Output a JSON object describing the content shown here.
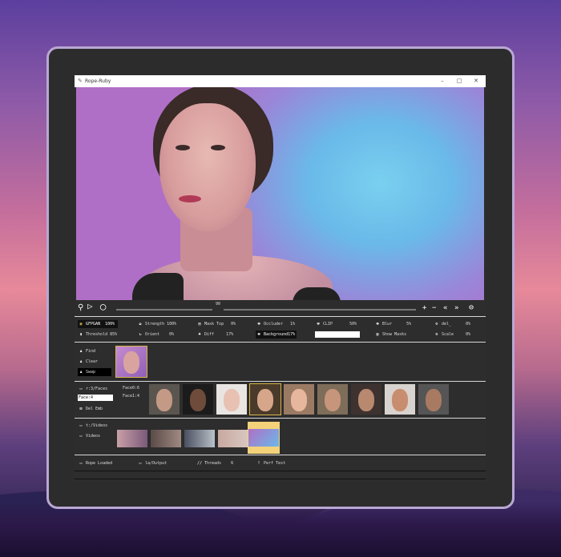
{
  "window": {
    "title": "Rope-Ruby"
  },
  "playback": {
    "frame": "90"
  },
  "options_row1": [
    {
      "name": "GFPGAN",
      "value": "100%",
      "selected": true
    },
    {
      "name": "Strength",
      "value": "100%"
    },
    {
      "name": "Diff",
      "value": "1%"
    },
    {
      "name": "Occluder",
      "value": "1%"
    },
    {
      "name": "CLIP",
      "value": "50%"
    },
    {
      "name": "Blur",
      "value": "5%"
    },
    {
      "name": "del_",
      "value": "0%"
    }
  ],
  "options_row2": [
    {
      "name": "Threshold",
      "value": "85%"
    },
    {
      "name": "Orient",
      "value": "0%"
    },
    {
      "name": "Diff",
      "value": "17%"
    },
    {
      "name": "Background",
      "value": "17%",
      "selected": true
    },
    {
      "name": "Show Masks",
      "value": ""
    },
    {
      "name": "Scale",
      "value": "0%"
    }
  ],
  "options_row1_labels": {
    "mask_top": "Mask Top",
    "mask_top_value": "0%"
  },
  "source_panel": {
    "find": "Find",
    "clear": "Clear",
    "swap": "Swap"
  },
  "faces_panel": {
    "folder": "r:3/Faces",
    "input_value": "Face:4",
    "del_emb": "Del Emb",
    "count_a": "Face0:6",
    "count_b": "Face1:4"
  },
  "videos_panel": {
    "folder": "t:/Videos",
    "label": "Videos"
  },
  "status_bar": {
    "rope_loaded": "Rope Loaded",
    "output": "la/Output",
    "threads_label": "Threads",
    "threads_value": "6",
    "perf_test": "Perf Test"
  }
}
